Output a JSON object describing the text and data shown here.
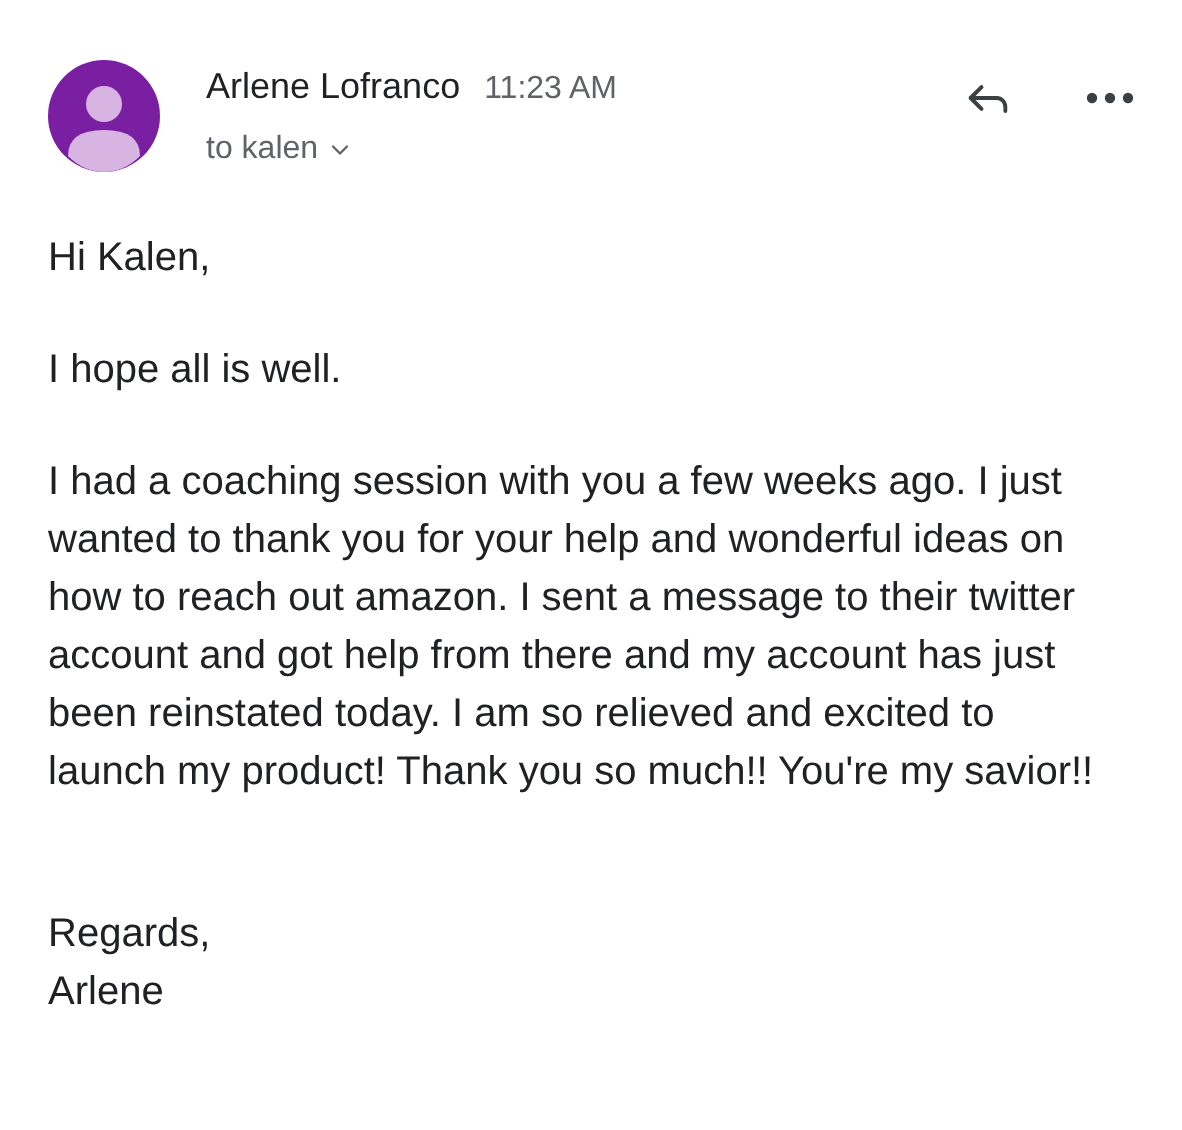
{
  "header": {
    "sender": "Arlene Lofranco",
    "time": "11:23 AM",
    "recipient": "to kalen"
  },
  "body": [
    "Hi Kalen,",
    "I hope all is well.",
    "I had a coaching session with you a few weeks ago. I just wanted to thank you for your help and wonderful ideas on how to reach out amazon. I sent a message to their twitter account and got help from there and my account has just been reinstated today. I am so relieved and excited to launch my product! Thank you so much!! You're my savior!!"
  ],
  "signoff": [
    "Regards,",
    "Arlene"
  ]
}
